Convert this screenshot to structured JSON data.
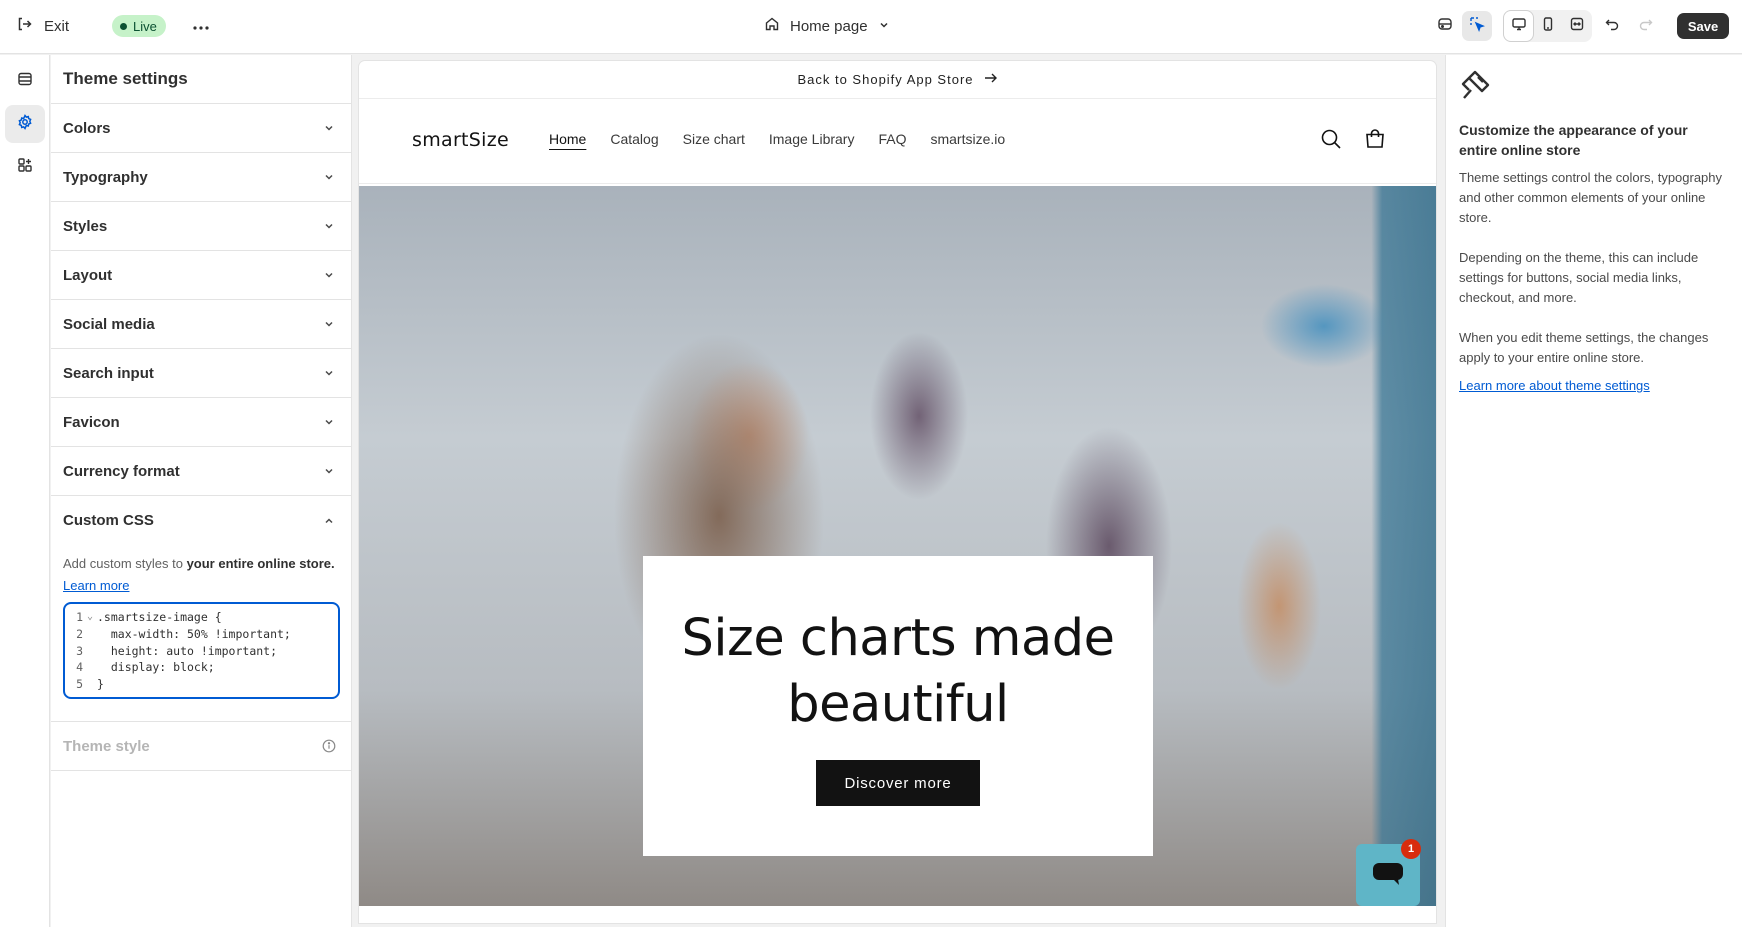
{
  "topbar": {
    "exit_label": "Exit",
    "status_label": "Live",
    "page_label": "Home page",
    "save_label": "Save"
  },
  "rail": {
    "items": [
      "sections",
      "theme-settings",
      "app-embeds"
    ]
  },
  "settings": {
    "title": "Theme settings",
    "sections": [
      {
        "label": "Colors"
      },
      {
        "label": "Typography"
      },
      {
        "label": "Styles"
      },
      {
        "label": "Layout"
      },
      {
        "label": "Social media"
      },
      {
        "label": "Search input"
      },
      {
        "label": "Favicon"
      },
      {
        "label": "Currency format"
      }
    ],
    "custom_css": {
      "label": "Custom CSS",
      "desc_prefix": "Add custom styles to ",
      "desc_bold": "your entire online store.",
      "learn_more": "Learn more",
      "code_lines": [
        {
          "n": "1",
          "text": ".smartsize-image {"
        },
        {
          "n": "2",
          "text": "  max-width: 50% !important;"
        },
        {
          "n": "3",
          "text": "  height: auto !important;"
        },
        {
          "n": "4",
          "text": "  display: block;"
        },
        {
          "n": "5",
          "text": "}"
        }
      ]
    },
    "theme_style_label": "Theme style"
  },
  "store": {
    "announcement": "Back to Shopify App Store",
    "logo": "smartSize",
    "nav": [
      "Home",
      "Catalog",
      "Size chart",
      "Image Library",
      "FAQ",
      "smartsize.io"
    ],
    "hero_title_line1": "Size charts made",
    "hero_title_line2": "beautiful",
    "hero_button": "Discover more",
    "chat_badge": "1"
  },
  "info": {
    "title": "Customize the appearance of your entire online store",
    "p1": "Theme settings control the colors, typography and other common elements of your online store.",
    "p2": "Depending on the theme, this can include settings for buttons, social media links, checkout, and more.",
    "p3": "When you edit theme settings, the changes apply to your entire online store.",
    "link": "Learn more about theme settings"
  },
  "colors": {
    "accent": "#005bd3",
    "live_bg": "#c6f2c9",
    "save_bg": "#303030"
  }
}
